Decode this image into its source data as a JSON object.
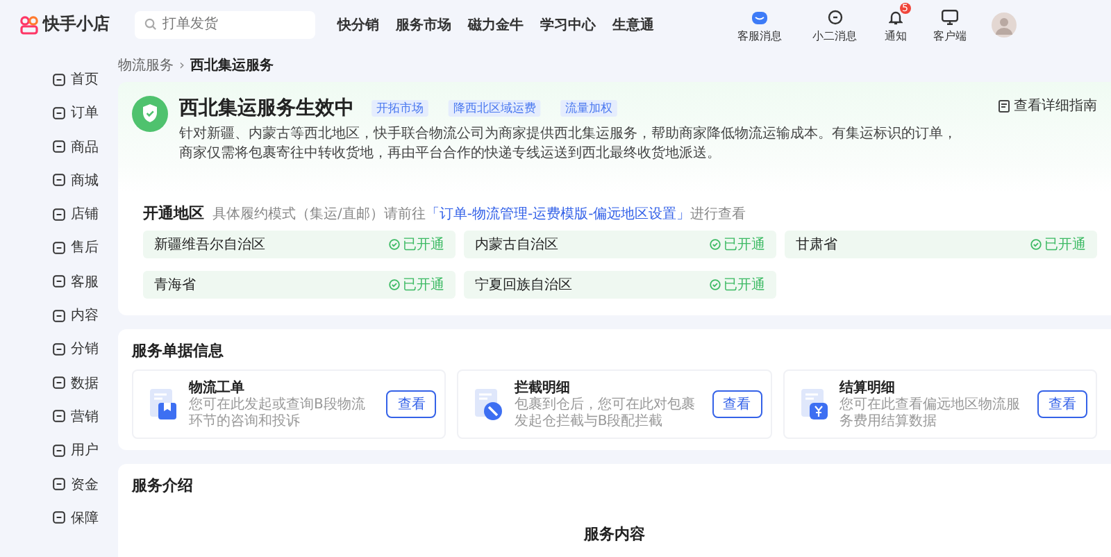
{
  "logo": {
    "text": "快手小店"
  },
  "search": {
    "placeholder": "打单发货"
  },
  "nav": [
    "快分销",
    "服务市场",
    "磁力金牛",
    "学习中心",
    "生意通"
  ],
  "header_actions": [
    {
      "kind": "chat",
      "label": "客服消息"
    },
    {
      "kind": "message",
      "label": "小二消息"
    },
    {
      "kind": "bell",
      "label": "通知",
      "badge": "5"
    },
    {
      "kind": "monitor",
      "label": "客户端"
    }
  ],
  "sidebar": {
    "items": [
      {
        "label": "首页",
        "selected": false
      },
      {
        "label": "订单",
        "selected": false
      },
      {
        "label": "商品",
        "selected": false
      },
      {
        "label": "商城",
        "selected": false
      },
      {
        "label": "店铺",
        "selected": false
      },
      {
        "label": "售后",
        "selected": false
      },
      {
        "label": "客服",
        "selected": false
      },
      {
        "label": "内容",
        "selected": false
      },
      {
        "label": "分销",
        "selected": false
      },
      {
        "label": "数据",
        "selected": false
      },
      {
        "label": "营销",
        "selected": false
      },
      {
        "label": "用户",
        "selected": false
      },
      {
        "label": "资金",
        "selected": false
      },
      {
        "label": "保障",
        "selected": false
      }
    ]
  },
  "breadcrumb": [
    {
      "label": "物流服务"
    },
    {
      "label": "西北集运服务"
    }
  ],
  "breadcrumb_separator": "›",
  "service": {
    "title": "西北集运服务生效中",
    "tags": [
      "开拓市场",
      "降西北区域运费",
      "流量加权"
    ],
    "description": "针对新疆、内蒙古等西北地区，快手联合物流公司为商家提供西北集运服务，帮助商家降低物流运输成本。有集运标识的订单，商家仅需将包裹寄往中转收货地，再由平台合作的快递专线运送到西北最终收货地派送。",
    "guide_link": "查看详细指南"
  },
  "regions": {
    "title": "开通地区",
    "hint_before": "具体履约模式（集运/直邮）请前往",
    "hint_link": "「订单-物流管理-运费模版-偏远地区设置」",
    "hint_after": "进行查看",
    "items": [
      {
        "name": "新疆维吾尔自治区",
        "status": "已开通"
      },
      {
        "name": "内蒙古自治区",
        "status": "已开通"
      },
      {
        "name": "甘肃省",
        "status": "已开通"
      },
      {
        "name": "青海省",
        "status": "已开通"
      },
      {
        "name": "宁夏回族自治区",
        "status": "已开通"
      }
    ]
  },
  "documents": {
    "title": "服务单据信息",
    "cards": [
      {
        "kind": "bookmark",
        "title": "物流工单",
        "description": "您可在此发起或查询B段物流环节的咨询和投诉",
        "button": "查看"
      },
      {
        "kind": "block",
        "title": "拦截明细",
        "description": "包裹到仓后，您可在此对包裹发起仓拦截与B段配拦截",
        "button": "查看"
      },
      {
        "kind": "yen",
        "title": "结算明细",
        "description": "您可在此查看偏远地区物流服务费用结算数据",
        "button": "查看"
      }
    ]
  },
  "intro": {
    "title": "服务介绍",
    "subtitle": "服务内容"
  }
}
